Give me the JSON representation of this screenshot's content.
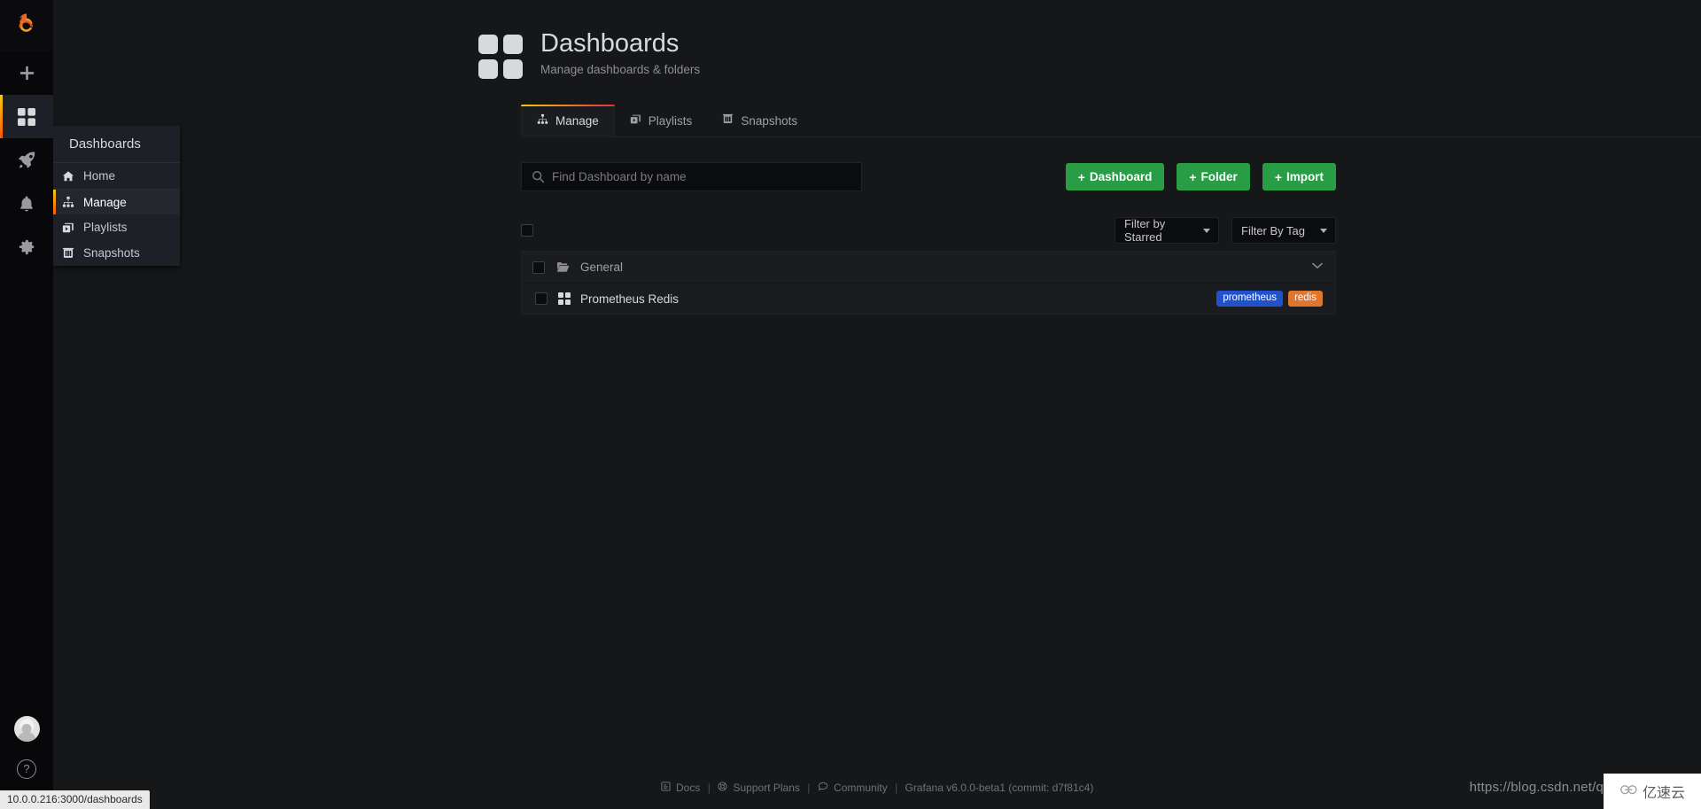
{
  "app": {
    "brand_icon": "grafana-logo-icon",
    "status_url": "10.0.0.216:3000/dashboards"
  },
  "sidenav": {
    "items": [
      {
        "name": "create",
        "icon": "plus-icon",
        "glyph": "+"
      },
      {
        "name": "dashboards",
        "icon": "dashboards-icon",
        "active": true
      },
      {
        "name": "explore",
        "icon": "rocket-icon"
      },
      {
        "name": "alerting",
        "icon": "bell-icon"
      },
      {
        "name": "configuration",
        "icon": "gear-icon"
      }
    ],
    "avatar": "user-avatar",
    "help": "?"
  },
  "flyout": {
    "title": "Dashboards",
    "items": [
      {
        "label": "Home",
        "icon": "home-icon",
        "active": false
      },
      {
        "label": "Manage",
        "icon": "sitemap-icon",
        "active": true
      },
      {
        "label": "Playlists",
        "icon": "playlist-icon",
        "active": false
      },
      {
        "label": "Snapshots",
        "icon": "snapshot-icon",
        "active": false
      }
    ]
  },
  "header": {
    "title": "Dashboards",
    "subtitle": "Manage dashboards & folders",
    "icon": "dashboards-grid-icon"
  },
  "tabs": [
    {
      "label": "Manage",
      "icon": "sitemap-icon",
      "active": true
    },
    {
      "label": "Playlists",
      "icon": "playlist-icon",
      "active": false
    },
    {
      "label": "Snapshots",
      "icon": "snapshot-icon",
      "active": false
    }
  ],
  "search": {
    "placeholder": "Find Dashboard by name",
    "value": "",
    "icon": "search-icon"
  },
  "actions": [
    {
      "label": "Dashboard",
      "icon": "plus-icon"
    },
    {
      "label": "Folder",
      "icon": "plus-icon"
    },
    {
      "label": "Import",
      "icon": "plus-icon"
    }
  ],
  "filters": [
    {
      "label": "Filter by Starred",
      "icon": "chevron-down-icon"
    },
    {
      "label": "Filter By Tag",
      "icon": "chevron-down-icon"
    }
  ],
  "results": {
    "folder": {
      "name": "General",
      "icon": "folder-open-icon",
      "collapse_icon": "chevron-down-icon"
    },
    "dashboards": [
      {
        "name": "Prometheus Redis",
        "icon": "dashboard-grid-icon",
        "tags": [
          {
            "label": "prometheus",
            "color": "#2251cc"
          },
          {
            "label": "redis",
            "color": "#e0752d"
          }
        ]
      }
    ]
  },
  "footer": {
    "links": [
      {
        "label": "Docs",
        "icon": "doc-icon"
      },
      {
        "label": "Support Plans",
        "icon": "lifebuoy-icon"
      },
      {
        "label": "Community",
        "icon": "comment-icon"
      }
    ],
    "version": "Grafana v6.0.0-beta1 (commit: d7f81c4)"
  },
  "watermark": {
    "url": "https://blog.csdn.net/q",
    "logo_text": "亿速云",
    "logo_icon": "cloud-icon"
  },
  "colors": {
    "accent_start": "#f2cc0c",
    "accent_end": "#e02f44",
    "green": "#299c46",
    "tag_blue": "#2251cc",
    "tag_orange": "#e0752d",
    "bg": "#161719",
    "panel": "#1b1c1f"
  }
}
